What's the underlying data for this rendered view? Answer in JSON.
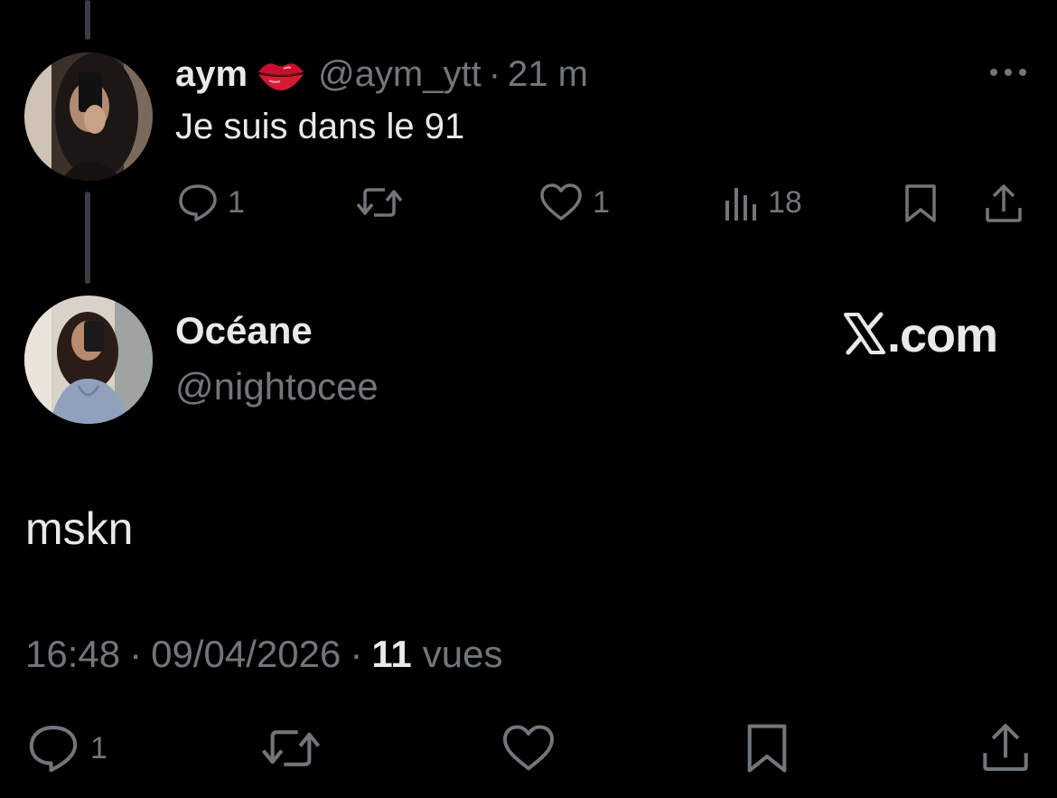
{
  "reply": {
    "name": "aym",
    "handle": "@aym_ytt",
    "separator": "·",
    "time": "21 m",
    "text": "Je suis dans le 91",
    "icons": {
      "badge": "lips-icon",
      "more": "more-icon"
    },
    "actions": {
      "replies": "1",
      "reposts": "",
      "likes": "1",
      "views": "18"
    }
  },
  "main": {
    "name": "Océane",
    "handle": "@nightocee",
    "brand": ".com",
    "text": "mskn",
    "time": "16:48",
    "separator": "·",
    "date": "09/04/2026",
    "views_count": "11",
    "views_label": "vues",
    "actions": {
      "replies": "1"
    }
  },
  "colors": {
    "background": "#000000",
    "primary_text": "#e7e9ea",
    "secondary_text": "#71767b",
    "lips": "#c8102e"
  }
}
